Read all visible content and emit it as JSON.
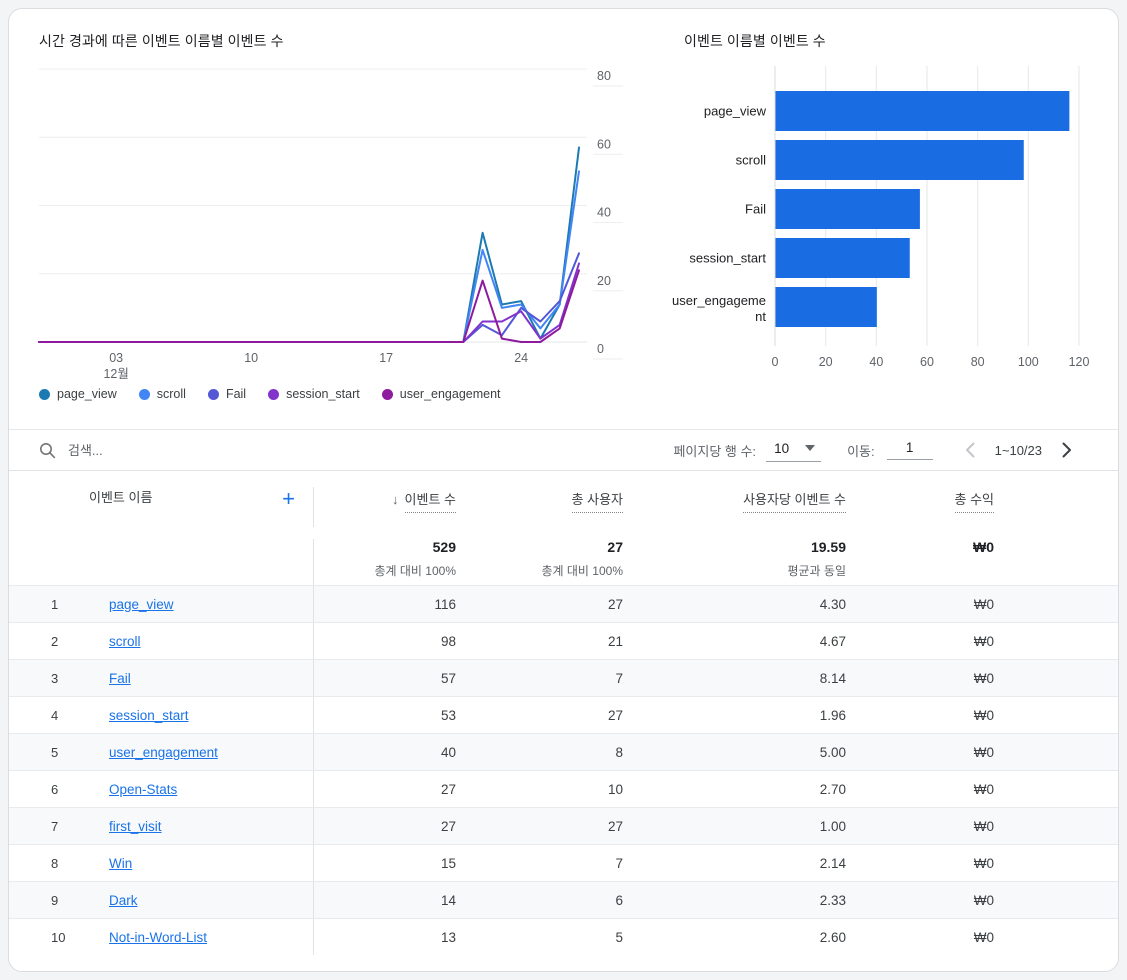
{
  "line_chart": {
    "type": "line",
    "title": "시간 경과에 따른 이벤트 이름별 이벤트 수",
    "y_ticks": [
      0,
      20,
      40,
      60,
      80
    ],
    "y_max": 80,
    "x_range": "2023-11-29 ~ 12-27",
    "x_tick_marks": [
      {
        "label": "03",
        "sublabel": "12월",
        "index": 4
      },
      {
        "label": "10",
        "sublabel": "",
        "index": 11
      },
      {
        "label": "17",
        "sublabel": "",
        "index": 18
      },
      {
        "label": "24",
        "sublabel": "",
        "index": 25
      }
    ],
    "series": [
      {
        "name": "page_view",
        "color": "#1c7ab2",
        "values": [
          0,
          0,
          0,
          0,
          0,
          0,
          0,
          0,
          0,
          0,
          0,
          0,
          0,
          0,
          0,
          0,
          0,
          0,
          0,
          0,
          0,
          0,
          0,
          32,
          11,
          12,
          1,
          11,
          57
        ]
      },
      {
        "name": "scroll",
        "color": "#4285f4",
        "values": [
          0,
          0,
          0,
          0,
          0,
          0,
          0,
          0,
          0,
          0,
          0,
          0,
          0,
          0,
          0,
          0,
          0,
          0,
          0,
          0,
          0,
          0,
          0,
          27,
          10,
          11,
          4,
          11,
          50
        ]
      },
      {
        "name": "Fail",
        "color": "#5357d6",
        "values": [
          0,
          0,
          0,
          0,
          0,
          0,
          0,
          0,
          0,
          0,
          0,
          0,
          0,
          0,
          0,
          0,
          0,
          0,
          0,
          0,
          0,
          0,
          0,
          5,
          2,
          10,
          6,
          12,
          26
        ]
      },
      {
        "name": "session_start",
        "color": "#8133cc",
        "values": [
          0,
          0,
          0,
          0,
          0,
          0,
          0,
          0,
          0,
          0,
          0,
          0,
          0,
          0,
          0,
          0,
          0,
          0,
          0,
          0,
          0,
          0,
          0,
          6,
          6,
          9,
          1,
          5,
          23
        ]
      },
      {
        "name": "user_engagement",
        "color": "#8e1a9e",
        "values": [
          0,
          0,
          0,
          0,
          0,
          0,
          0,
          0,
          0,
          0,
          0,
          0,
          0,
          0,
          0,
          0,
          0,
          0,
          0,
          0,
          0,
          0,
          0,
          18,
          1,
          0,
          0,
          4,
          21
        ]
      }
    ]
  },
  "bar_chart": {
    "type": "bar",
    "title": "이벤트 이름별 이벤트 수",
    "x_ticks": [
      0,
      20,
      40,
      60,
      80,
      100,
      120
    ],
    "x_max": 120,
    "bar_color": "#1a6ce3",
    "categories": [
      {
        "label": "page_view",
        "lines": [
          "page_view"
        ],
        "value": 116
      },
      {
        "label": "scroll",
        "lines": [
          "scroll"
        ],
        "value": 98
      },
      {
        "label": "Fail",
        "lines": [
          "Fail"
        ],
        "value": 57
      },
      {
        "label": "session_start",
        "lines": [
          "session_start"
        ],
        "value": 53
      },
      {
        "label": "user_engagement",
        "lines": [
          "user_engageme",
          "nt"
        ],
        "value": 40
      }
    ]
  },
  "toolbar": {
    "search_placeholder": "검색...",
    "rows_per_page_label": "페이지당 행 수:",
    "rows_per_page_value": "10",
    "goto_label": "이동:",
    "goto_value": "1",
    "range_text": "1~10/23"
  },
  "table": {
    "headers": {
      "name": "이벤트 이름",
      "events": "이벤트 수",
      "users": "총 사용자",
      "per_user": "사용자당 이벤트 수",
      "revenue": "총 수익",
      "sort_icon": "↓",
      "add_icon": "+"
    },
    "totals": {
      "events": "529",
      "events_note": "총계 대비 100%",
      "users": "27",
      "users_note": "총계 대비 100%",
      "per_user": "19.59",
      "per_user_note": "평균과 동일",
      "revenue": "₩0"
    },
    "rows": [
      {
        "num": "1",
        "name": "page_view",
        "events": "116",
        "users": "27",
        "per_user": "4.30",
        "revenue": "₩0"
      },
      {
        "num": "2",
        "name": "scroll",
        "events": "98",
        "users": "21",
        "per_user": "4.67",
        "revenue": "₩0"
      },
      {
        "num": "3",
        "name": "Fail",
        "events": "57",
        "users": "7",
        "per_user": "8.14",
        "revenue": "₩0"
      },
      {
        "num": "4",
        "name": "session_start",
        "events": "53",
        "users": "27",
        "per_user": "1.96",
        "revenue": "₩0"
      },
      {
        "num": "5",
        "name": "user_engagement",
        "events": "40",
        "users": "8",
        "per_user": "5.00",
        "revenue": "₩0"
      },
      {
        "num": "6",
        "name": "Open-Stats",
        "events": "27",
        "users": "10",
        "per_user": "2.70",
        "revenue": "₩0"
      },
      {
        "num": "7",
        "name": "first_visit",
        "events": "27",
        "users": "27",
        "per_user": "1.00",
        "revenue": "₩0"
      },
      {
        "num": "8",
        "name": "Win",
        "events": "15",
        "users": "7",
        "per_user": "2.14",
        "revenue": "₩0"
      },
      {
        "num": "9",
        "name": "Dark",
        "events": "14",
        "users": "6",
        "per_user": "2.33",
        "revenue": "₩0"
      },
      {
        "num": "10",
        "name": "Not-in-Word-List",
        "events": "13",
        "users": "5",
        "per_user": "2.60",
        "revenue": "₩0"
      }
    ]
  }
}
